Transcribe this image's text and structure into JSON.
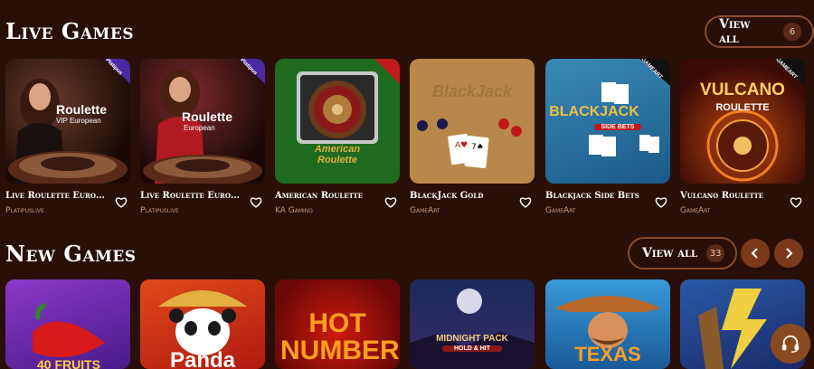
{
  "colors": {
    "background": "#2a0f08",
    "accent": "#8a4a2a",
    "provider": "#c89a7a"
  },
  "live": {
    "title": "Live Games",
    "view_all": "View all",
    "count": "6",
    "games": [
      {
        "name": "Live Roulette European...",
        "provider": "Platipuslive",
        "art": "Roulette",
        "art_sub": "VIP European",
        "badge": "Platipus"
      },
      {
        "name": "Live Roulette European",
        "provider": "Platipuslive",
        "art": "Roulette",
        "art_sub": "European",
        "badge": "Platipus"
      },
      {
        "name": "American Roulette",
        "provider": "KA Gaming",
        "art": "American Roulette"
      },
      {
        "name": "BlackJack Gold",
        "provider": "GameArt",
        "art": "BlackJack"
      },
      {
        "name": "Blackjack Side Bets",
        "provider": "GameArt",
        "art": "BLACKJACK",
        "art_sub": "SIDE BETS",
        "badge": "GAMEART"
      },
      {
        "name": "Vulcano Roulette",
        "provider": "GameArt",
        "art": "VULCANO",
        "art_sub": "ROULETTE",
        "badge": "GAMEART"
      }
    ]
  },
  "new": {
    "title": "New Games",
    "view_all": "View all",
    "count": "33",
    "games": [
      {
        "art": "40 FRUITS"
      },
      {
        "art": "Panda"
      },
      {
        "art": "HOT NUMBERS"
      },
      {
        "art": "MIDNIGHT PACK",
        "art_sub": "HOLD & HIT"
      },
      {
        "art": "TEXAS"
      },
      {
        "art": ""
      }
    ]
  },
  "icons": {
    "heart": "heart-icon",
    "prev": "chevron-left-icon",
    "next": "chevron-right-icon",
    "support": "headset-icon"
  }
}
